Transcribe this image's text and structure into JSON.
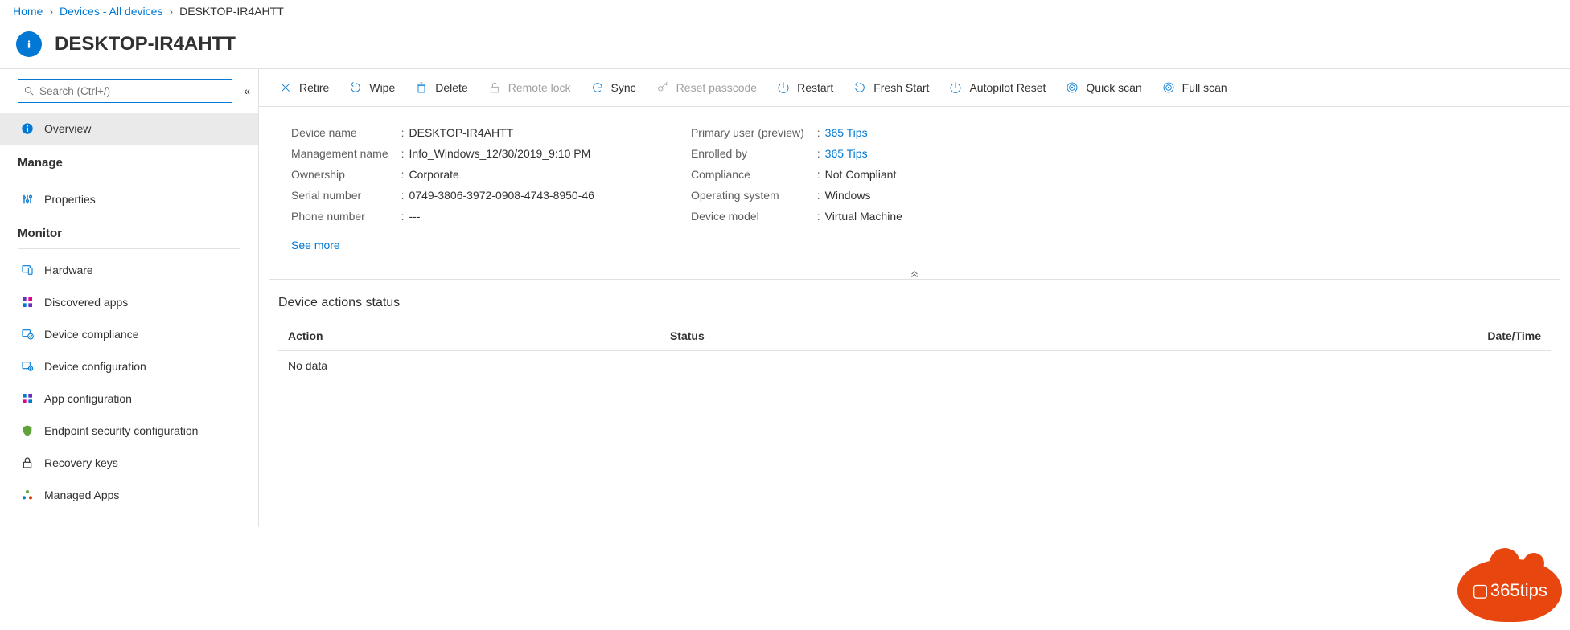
{
  "breadcrumb": [
    {
      "label": "Home",
      "link": true
    },
    {
      "label": "Devices - All devices",
      "link": true
    },
    {
      "label": "DESKTOP-IR4AHTT",
      "link": false
    }
  ],
  "page_title": "DESKTOP-IR4AHTT",
  "search": {
    "placeholder": "Search (Ctrl+/)"
  },
  "sidebar": {
    "overview": "Overview",
    "sections": [
      {
        "header": "Manage",
        "items": [
          {
            "key": "properties",
            "label": "Properties",
            "icon": "sliders",
            "color": "#0078d4"
          }
        ]
      },
      {
        "header": "Monitor",
        "items": [
          {
            "key": "hardware",
            "label": "Hardware",
            "icon": "device",
            "color": "#0078d4"
          },
          {
            "key": "discovered-apps",
            "label": "Discovered apps",
            "icon": "grid",
            "color": "#6b2fbf"
          },
          {
            "key": "device-compliance",
            "label": "Device compliance",
            "icon": "device-check",
            "color": "#0078d4"
          },
          {
            "key": "device-configuration",
            "label": "Device configuration",
            "icon": "device-gear",
            "color": "#0078d4"
          },
          {
            "key": "app-configuration",
            "label": "App configuration",
            "icon": "grid2",
            "color": "#6b2fbf"
          },
          {
            "key": "endpoint-security",
            "label": "Endpoint security configuration",
            "icon": "shield",
            "color": "#5fa33a"
          },
          {
            "key": "recovery-keys",
            "label": "Recovery keys",
            "icon": "lock",
            "color": "#323130"
          },
          {
            "key": "managed-apps",
            "label": "Managed Apps",
            "icon": "cluster",
            "color": "#5fa33a"
          }
        ]
      }
    ]
  },
  "toolbar": [
    {
      "key": "retire",
      "label": "Retire",
      "icon": "x",
      "disabled": false
    },
    {
      "key": "wipe",
      "label": "Wipe",
      "icon": "undo",
      "disabled": false
    },
    {
      "key": "delete",
      "label": "Delete",
      "icon": "trash",
      "disabled": false
    },
    {
      "key": "remote-lock",
      "label": "Remote lock",
      "icon": "lock-open",
      "disabled": true
    },
    {
      "key": "sync",
      "label": "Sync",
      "icon": "refresh",
      "disabled": false
    },
    {
      "key": "reset-passcode",
      "label": "Reset passcode",
      "icon": "key",
      "disabled": true
    },
    {
      "key": "restart",
      "label": "Restart",
      "icon": "power",
      "disabled": false
    },
    {
      "key": "fresh-start",
      "label": "Fresh Start",
      "icon": "undo",
      "disabled": false
    },
    {
      "key": "autopilot-reset",
      "label": "Autopilot Reset",
      "icon": "power",
      "disabled": false
    },
    {
      "key": "quick-scan",
      "label": "Quick scan",
      "icon": "target",
      "disabled": false
    },
    {
      "key": "full-scan",
      "label": "Full scan",
      "icon": "target",
      "disabled": false
    }
  ],
  "properties_left": [
    {
      "label": "Device name",
      "value": "DESKTOP-IR4AHTT"
    },
    {
      "label": "Management name",
      "value": "Info_Windows_12/30/2019_9:10 PM"
    },
    {
      "label": "Ownership",
      "value": "Corporate"
    },
    {
      "label": "Serial number",
      "value": "0749-3806-3972-0908-4743-8950-46"
    },
    {
      "label": "Phone number",
      "value": "---"
    }
  ],
  "properties_right": [
    {
      "label": "Primary user (preview)",
      "value": "365 Tips",
      "link": true
    },
    {
      "label": "Enrolled by",
      "value": "365 Tips",
      "link": true
    },
    {
      "label": "Compliance",
      "value": "Not Compliant"
    },
    {
      "label": "Operating system",
      "value": "Windows"
    },
    {
      "label": "Device model",
      "value": "Virtual Machine"
    }
  ],
  "see_more": "See more",
  "actions_section": {
    "title": "Device actions status",
    "cols": [
      "Action",
      "Status",
      "Date/Time"
    ],
    "empty": "No data"
  },
  "watermark": "365tips"
}
